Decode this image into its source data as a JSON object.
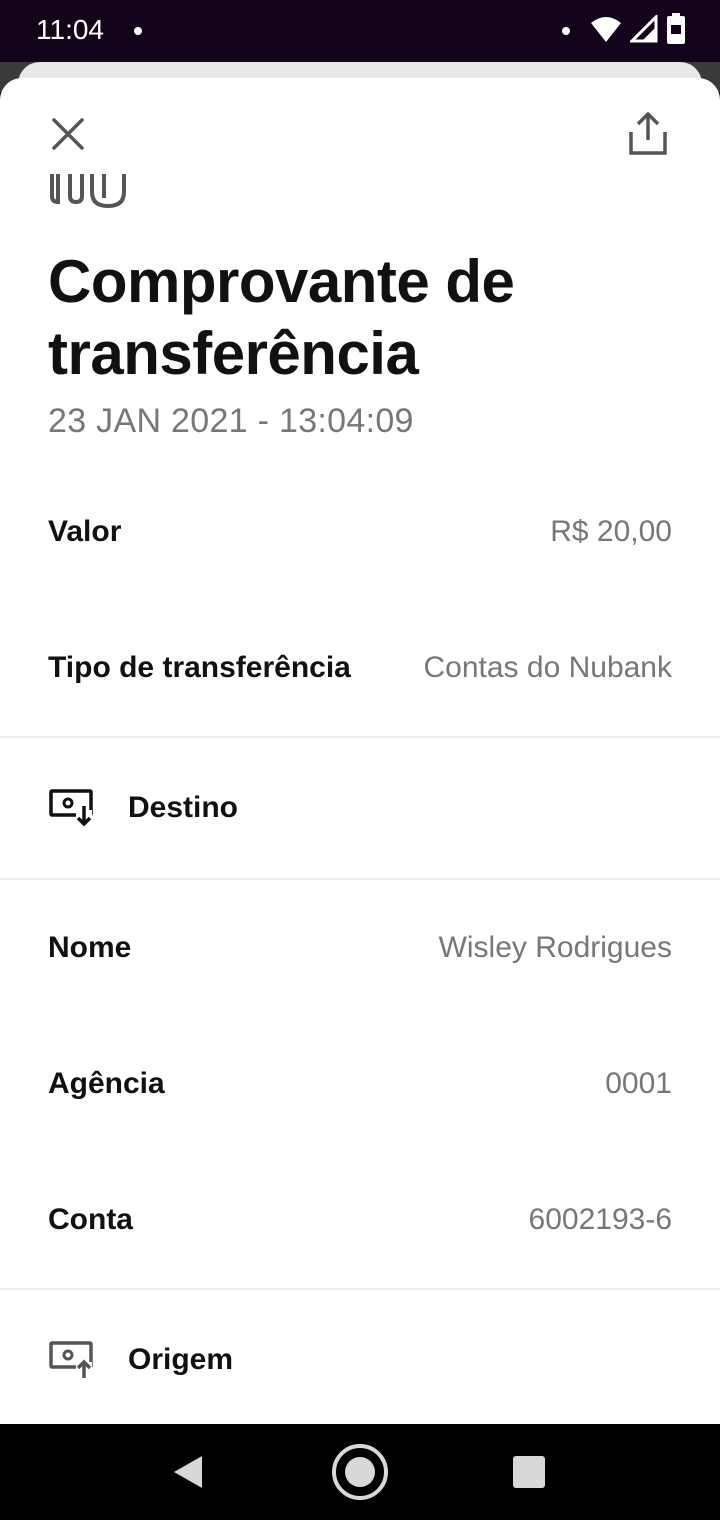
{
  "status_bar": {
    "time": "11:04",
    "icons": [
      "notification-dot-icon",
      "wifi-icon",
      "signal-icon",
      "battery-icon"
    ]
  },
  "header": {
    "close_icon": "close-icon",
    "share_icon": "share-icon"
  },
  "receipt": {
    "title": "Comprovante de transferência",
    "timestamp": "23 JAN 2021 - 13:04:09",
    "fields": [
      {
        "label": "Valor",
        "value": "R$ 20,00"
      },
      {
        "label": "Tipo de transferência",
        "value": "Contas do Nubank"
      }
    ],
    "destination": {
      "section_label": "Destino",
      "icon": "money-in-icon",
      "fields": [
        {
          "label": "Nome",
          "value": "Wisley Rodrigues"
        },
        {
          "label": "Agência",
          "value": "0001"
        },
        {
          "label": "Conta",
          "value": "6002193-6"
        }
      ]
    },
    "origin": {
      "section_label": "Origem",
      "icon": "money-out-icon"
    }
  },
  "nav_bar": {
    "icons": [
      "back-icon",
      "home-icon",
      "recents-icon"
    ]
  },
  "colors": {
    "status_bar_bg": "#13041b",
    "text_primary": "#111111",
    "text_secondary": "#777777",
    "divider": "#ececec"
  }
}
